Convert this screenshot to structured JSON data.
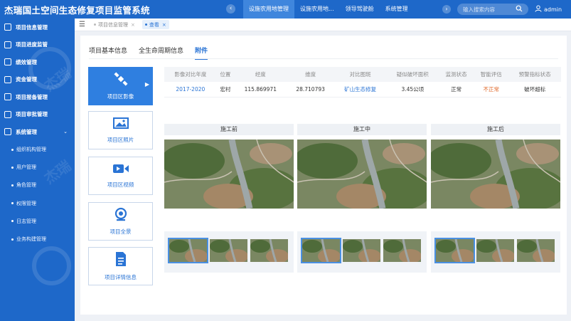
{
  "app": {
    "title": "杰瑞国土空间生态修复项目监管系统"
  },
  "topnav": {
    "items": [
      {
        "label": "设施农用地管理",
        "active": true
      },
      {
        "label": "设施农用地...",
        "active": false
      },
      {
        "label": "领导驾驶舱",
        "active": false
      },
      {
        "label": "系统管理",
        "active": false
      }
    ],
    "search_placeholder": "输入搜索内容",
    "user": "admin"
  },
  "sidebar": {
    "items": [
      {
        "label": "项目信息管理"
      },
      {
        "label": "项目进度监管"
      },
      {
        "label": "绩效管理"
      },
      {
        "label": "资金管理"
      },
      {
        "label": "项目报备管理"
      },
      {
        "label": "项目审批管理"
      },
      {
        "label": "系统管理",
        "expanded": true
      }
    ],
    "subitems": [
      {
        "label": "组织机构管理"
      },
      {
        "label": "用户管理"
      },
      {
        "label": "角色管理"
      },
      {
        "label": "权限管理"
      },
      {
        "label": "日志管理"
      },
      {
        "label": "业务构建管理"
      }
    ]
  },
  "page_tabs": [
    {
      "label": "项目信息管理",
      "active": false
    },
    {
      "label": "查看",
      "active": true
    }
  ],
  "subtabs": [
    {
      "label": "项目基本信息",
      "active": false
    },
    {
      "label": "全生命周期信息",
      "active": false
    },
    {
      "label": "附件",
      "active": true
    }
  ],
  "categories": [
    {
      "label": "项目区影像",
      "icon": "satellite-icon",
      "active": true
    },
    {
      "label": "项目区照片",
      "icon": "photo-icon",
      "active": false
    },
    {
      "label": "项目区视频",
      "icon": "video-camera-icon",
      "active": false
    },
    {
      "label": "项目全景",
      "icon": "panorama-camera-icon",
      "active": false
    },
    {
      "label": "项目详情信息",
      "icon": "document-icon",
      "active": false
    }
  ],
  "table": {
    "headers": [
      "影像对比年度",
      "位置",
      "经度",
      "维度",
      "对比图斑",
      "疑似破坏面积",
      "监测状态",
      "智能评估",
      "预警指标状态"
    ],
    "row": [
      "2017-2020",
      "宏村",
      "115.869971",
      "28.710793",
      "矿山生态修复",
      "3.45公顷",
      "正常",
      "不正常",
      "破坏超标"
    ]
  },
  "colors": {
    "brand": "#1e68c9",
    "accent": "#2a74d5",
    "link": "#2a74d5",
    "warning": "#e06a2b"
  },
  "phases": [
    {
      "label": "施工前"
    },
    {
      "label": "施工中"
    },
    {
      "label": "施工后"
    }
  ]
}
